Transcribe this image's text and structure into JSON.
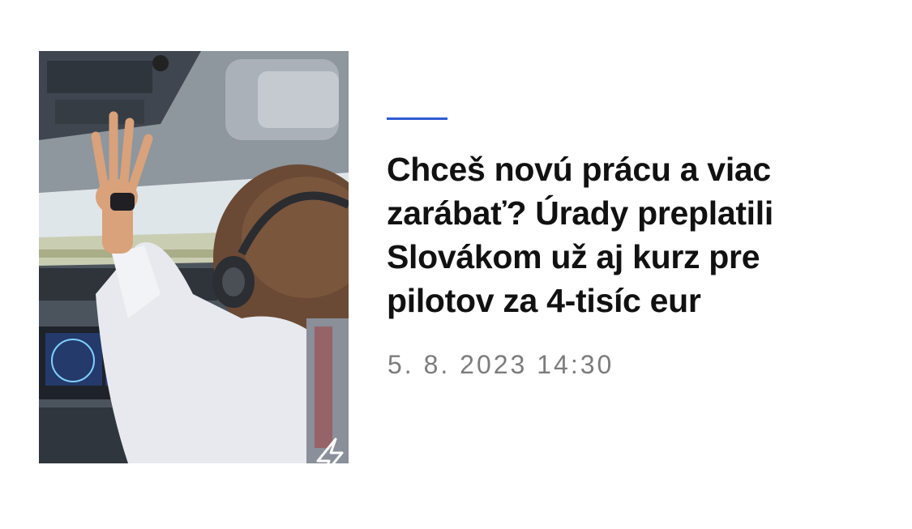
{
  "article": {
    "headline": "Chceš novú prácu a viac zarábať? Úrady preplatili Slovákom už aj kurz pre pilotov za 4-tisíc eur",
    "date": "5. 8. 2023 14:30",
    "accent_color": "#2f5bd3",
    "thumbnail": {
      "icon": "lightning-bolt-icon"
    }
  }
}
